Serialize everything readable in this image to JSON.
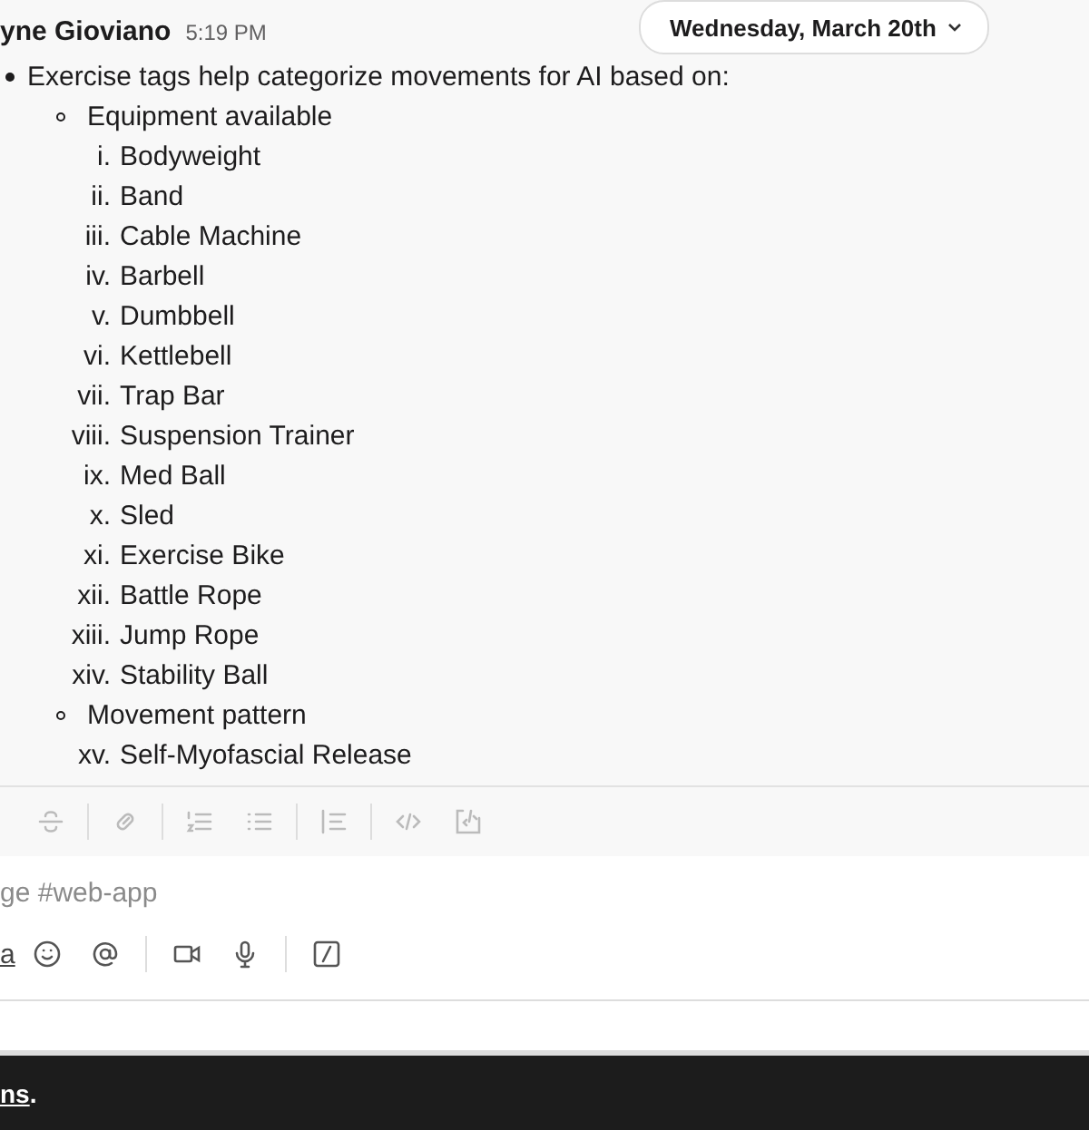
{
  "message": {
    "author": "yne Gioviano",
    "time": "5:19 PM",
    "date_pill": "Wednesday, March 20th",
    "text": "Exercise tags help categorize movements for AI based on:",
    "groups": [
      {
        "label": "Equipment available",
        "items": [
          {
            "marker": "i.",
            "text": "Bodyweight"
          },
          {
            "marker": "ii.",
            "text": "Band"
          },
          {
            "marker": "iii.",
            "text": "Cable Machine"
          },
          {
            "marker": "iv.",
            "text": "Barbell"
          },
          {
            "marker": "v.",
            "text": "Dumbbell"
          },
          {
            "marker": "vi.",
            "text": "Kettlebell"
          },
          {
            "marker": "vii.",
            "text": "Trap Bar"
          },
          {
            "marker": "viii.",
            "text": "Suspension Trainer"
          },
          {
            "marker": "ix.",
            "text": "Med Ball"
          },
          {
            "marker": "x.",
            "text": "Sled"
          },
          {
            "marker": "xi.",
            "text": "Exercise Bike"
          },
          {
            "marker": "xii.",
            "text": "Battle Rope"
          },
          {
            "marker": "xiii.",
            "text": "Jump Rope"
          },
          {
            "marker": "xiv.",
            "text": "Stability Ball"
          }
        ]
      },
      {
        "label": "Movement pattern",
        "items": [
          {
            "marker": "xv.",
            "text": "Self-Myofascial Release"
          }
        ]
      }
    ]
  },
  "composer": {
    "placeholder": "ge #web-app",
    "format_glyph": "a"
  },
  "banner": {
    "link": "ns",
    "tail": "."
  }
}
